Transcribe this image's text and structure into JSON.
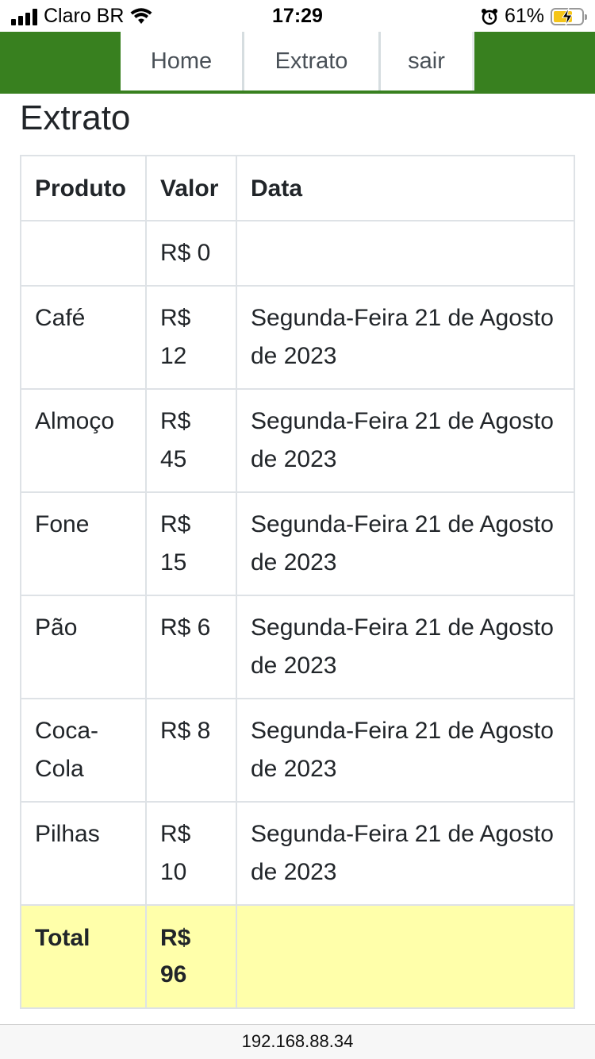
{
  "status_bar": {
    "carrier": "Claro BR",
    "time": "17:29",
    "battery": "61%"
  },
  "nav": {
    "items": [
      {
        "label": "Home"
      },
      {
        "label": "Extrato"
      },
      {
        "label": "sair"
      }
    ]
  },
  "page": {
    "title": "Extrato"
  },
  "table": {
    "headers": [
      "Produto",
      "Valor",
      "Data"
    ],
    "rows": [
      {
        "produto": "",
        "valor": "R$ 0",
        "data": ""
      },
      {
        "produto": "Café",
        "valor": "R$ 12",
        "data": "Segunda-Feira 21 de Agosto de 2023"
      },
      {
        "produto": "Almoço",
        "valor": "R$ 45",
        "data": "Segunda-Feira 21 de Agosto de 2023"
      },
      {
        "produto": "Fone",
        "valor": "R$ 15",
        "data": "Segunda-Feira 21 de Agosto de 2023"
      },
      {
        "produto": "Pão",
        "valor": "R$ 6",
        "data": "Segunda-Feira 21 de Agosto de 2023"
      },
      {
        "produto": "Coca-Cola",
        "valor": "R$ 8",
        "data": "Segunda-Feira 21 de Agosto de 2023"
      },
      {
        "produto": "Pilhas",
        "valor": "R$ 10",
        "data": "Segunda-Feira 21 de Agosto de 2023"
      }
    ],
    "total": {
      "label": "Total",
      "valor": "R$ 96",
      "data": ""
    }
  },
  "browser": {
    "url": "192.168.88.34"
  },
  "colors": {
    "navbar": "#38801f",
    "total_row": "#ffffaa",
    "border": "#dee2e6"
  }
}
